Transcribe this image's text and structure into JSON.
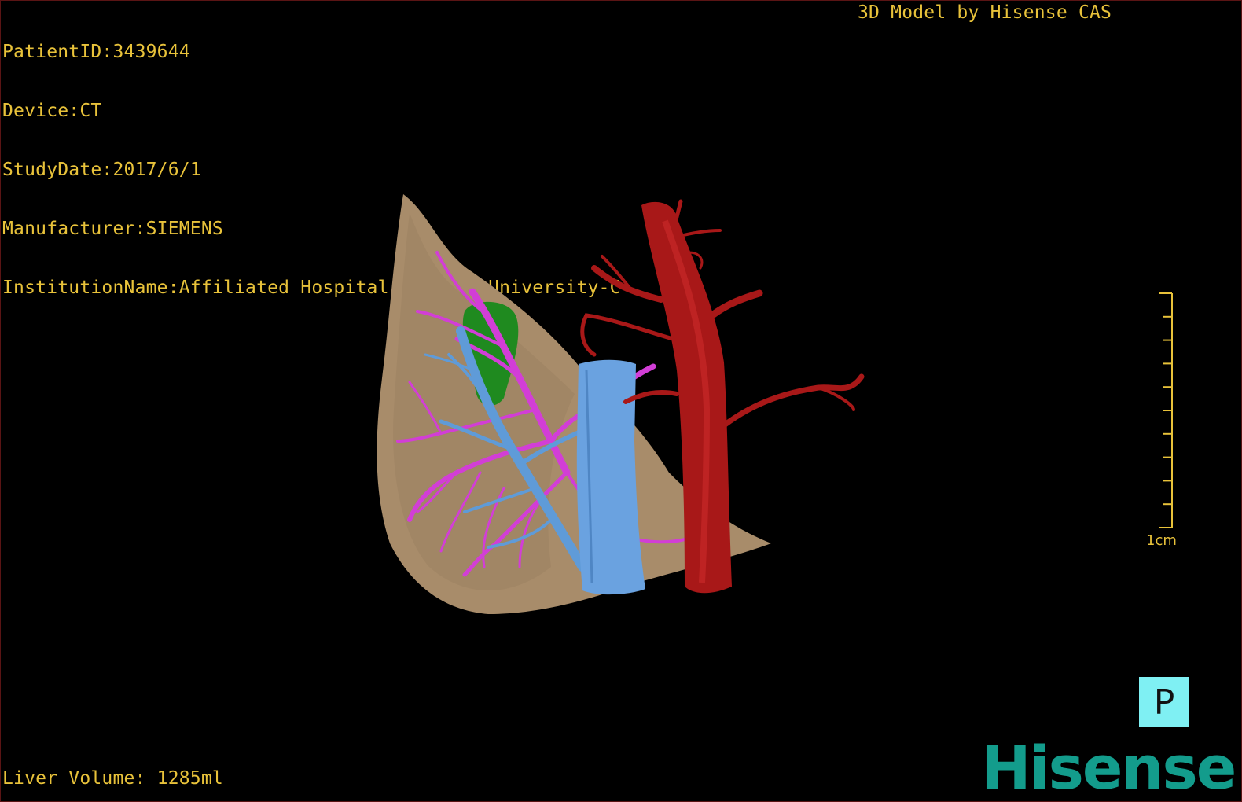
{
  "study_info": {
    "patient_id": "PatientID:3439644",
    "device": "Device:CT",
    "study_date": "StudyDate:2017/6/1",
    "manufacturer": "Manufacturer:SIEMENS",
    "institution": "InstitutionName:Affiliated Hospital Qingdao University-C"
  },
  "model_credit": "3D Model by Hisense CAS",
  "liver_volume": "Liver Volume: 1285ml",
  "scale_bar": {
    "label": "1cm",
    "ticks": 10
  },
  "orientation": {
    "label": "P"
  },
  "brand": "Hisense",
  "colors": {
    "text": "#e8c23a",
    "liver": "#a88c6a",
    "portal_vein": "#d23ed6",
    "hepatic_vein": "#5f9bd8",
    "artery": "#a81818",
    "gallbladder": "#1f8a1f",
    "orientation_box": "#7ff0f3",
    "brand": "#139c8c"
  }
}
